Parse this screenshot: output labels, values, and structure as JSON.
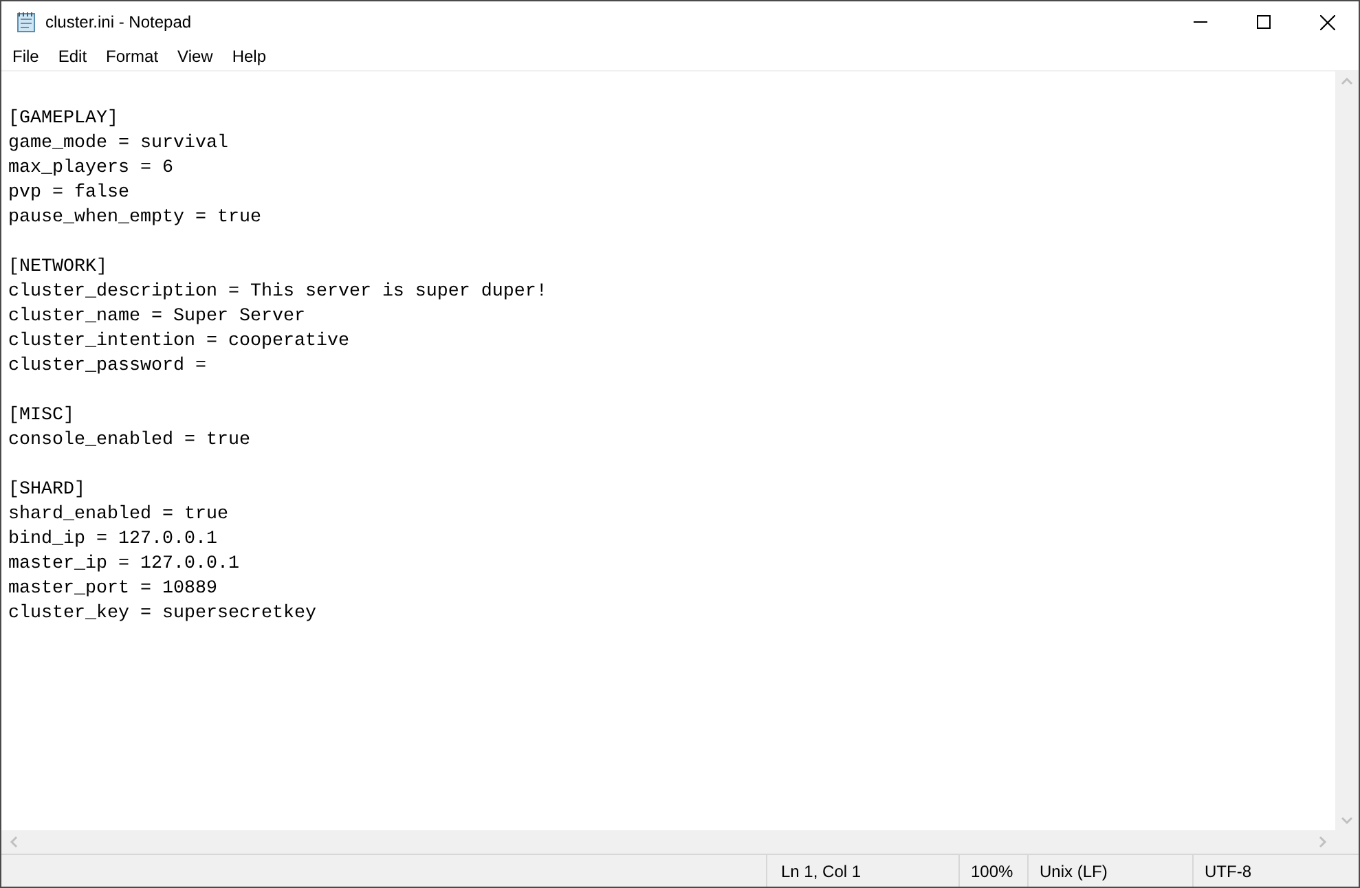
{
  "window": {
    "title": "cluster.ini - Notepad"
  },
  "menu": [
    "File",
    "Edit",
    "Format",
    "View",
    "Help"
  ],
  "editor": {
    "sections": [
      {
        "header": "[GAMEPLAY]",
        "lines": [
          "game_mode = survival",
          "max_players = 6",
          "pvp = false",
          "pause_when_empty = true"
        ]
      },
      {
        "header": "[NETWORK]",
        "lines": [
          "cluster_description = This server is super duper!",
          "cluster_name = Super Server",
          "cluster_intention = cooperative",
          "cluster_password ="
        ]
      },
      {
        "header": "[MISC]",
        "lines": [
          "console_enabled = true"
        ]
      },
      {
        "header": "[SHARD]",
        "lines": [
          "shard_enabled = true",
          "bind_ip = 127.0.0.1",
          "master_ip = 127.0.0.1",
          "master_port = 10889",
          "cluster_key = supersecretkey"
        ]
      }
    ]
  },
  "status_bar": {
    "position": "Ln 1, Col 1",
    "zoom": "100%",
    "line_endings": "Unix (LF)",
    "encoding": "UTF-8"
  }
}
